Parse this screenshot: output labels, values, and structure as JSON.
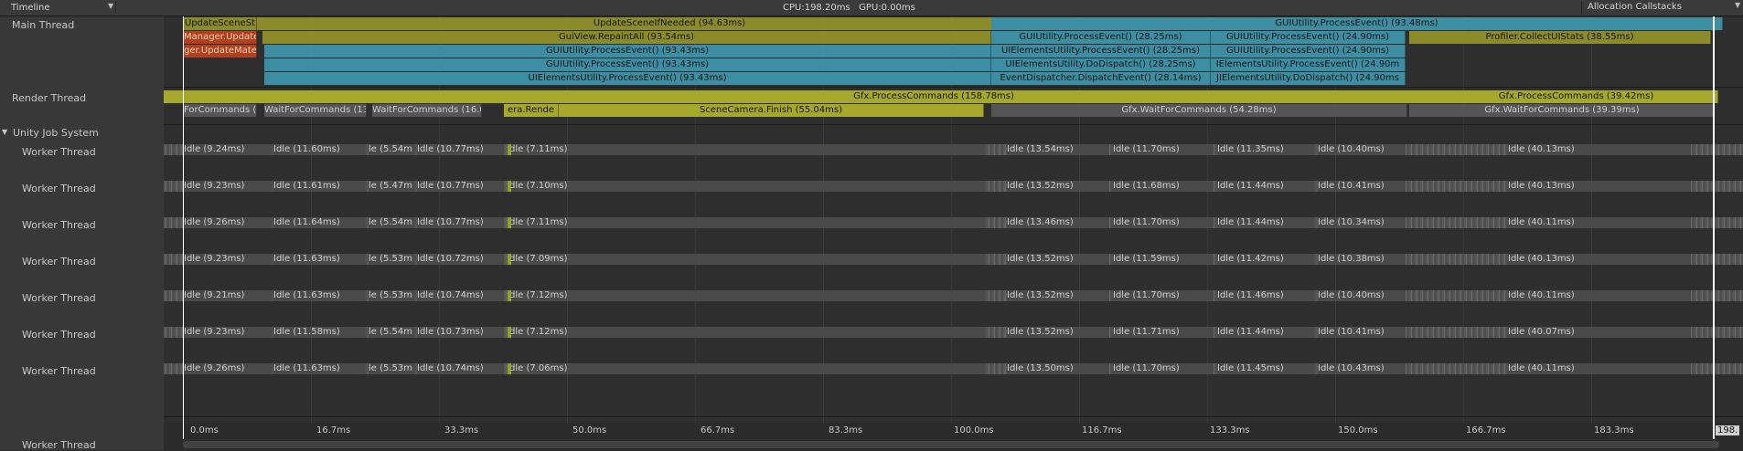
{
  "toolbar": {
    "timeline_label": "Timeline",
    "cpu_gpu": "CPU:198.20ms   GPU:0.00ms",
    "alloc_label": "Allocation Callstacks"
  },
  "threads": {
    "main": "Main Thread",
    "render": "Render Thread",
    "job_system": "Unity Job System",
    "worker": "Worker Thread"
  },
  "main_bars": {
    "r0": [
      "UpdateSceneSt",
      "UpdateSceneIfNeeded (94.63ms)",
      "GUIUtility.ProcessEvent() (93.48ms)"
    ],
    "r1": [
      "Manager.Update",
      "GuiView.RepaintAll (93.54ms)",
      "GUIUtility.ProcessEvent() (28.25ms)",
      "GUIUtility.ProcessEvent() (24.90ms)",
      "Profiler.CollectUIStats (38.55ms)"
    ],
    "r2": [
      "ger.UpdateMate",
      "GUIUtility.ProcessEvent() (93.43ms)",
      "UIElementsUtility.ProcessEvent() (28.25ms)",
      "GUIUtility.ProcessEvent() (24.90ms)"
    ],
    "r3": [
      "GUIUtility.ProcessEvent() (93.43ms)",
      "UIElementsUtility.DoDispatch() (28.25ms)",
      "IElementsUtility.ProcessEvent() (24.90m"
    ],
    "r4": [
      "UIElementsUtility.ProcessEvent() (93.43ms)",
      "EventDispatcher.DispatchEvent() (28.14ms)",
      "JIElementsUtility.DoDispatch() (24.90ms"
    ]
  },
  "render_bars": {
    "r0": [
      "Gfx.ProcessCommands (158.78ms)",
      "Gfx.ProcessCommands (39.42ms)"
    ],
    "r1": [
      "ForCommands (",
      "WaitForCommands (13.7",
      "WaitForCommands (16.01",
      "era.Rende",
      "SceneCamera.Finish (55.04ms)",
      "Gfx.WaitForCommands (54.28ms)",
      "Gfx.WaitForCommands (39.39ms)"
    ]
  },
  "worker_rows": [
    [
      "Idle (9.24ms)",
      "Idle (11.60ms)",
      "le (5.54m",
      "Idle (10.77ms)",
      "dle (7.11ms)",
      "Idle (13.54ms)",
      "Idle (11.70ms)",
      "Idle (11.35ms)",
      "Idle (10.40ms)",
      "Idle (40.13ms)"
    ],
    [
      "Idle (9.23ms)",
      "Idle (11.61ms)",
      "le (5.47m",
      "Idle (10.77ms)",
      "dle (7.10ms)",
      "Idle (13.52ms)",
      "Idle (11.68ms)",
      "Idle (11.44ms)",
      "Idle (10.41ms)",
      "Idle (40.13ms)"
    ],
    [
      "Idle (9.26ms)",
      "Idle (11.64ms)",
      "le (5.54m",
      "Idle (10.77ms)",
      "dle (7.11ms)",
      "Idle (13.46ms)",
      "Idle (11.70ms)",
      "Idle (11.44ms)",
      "Idle (10.34ms)",
      "Idle (40.11ms)"
    ],
    [
      "Idle (9.23ms)",
      "Idle (11.63ms)",
      "le (5.53m",
      "Idle (10.72ms)",
      "dle (7.09ms)",
      "Idle (13.52ms)",
      "Idle (11.59ms)",
      "Idle (11.42ms)",
      "Idle (10.38ms)",
      "Idle (40.13ms)"
    ],
    [
      "Idle (9.21ms)",
      "Idle (11.63ms)",
      "le (5.53m",
      "Idle (10.74ms)",
      "dle (7.12ms)",
      "Idle (13.52ms)",
      "Idle (11.70ms)",
      "Idle (11.46ms)",
      "Idle (10.40ms)",
      "Idle (40.11ms)"
    ],
    [
      "Idle (9.23ms)",
      "Idle (11.58ms)",
      "le (5.54m",
      "Idle (10.73ms)",
      "dle (7.12ms)",
      "Idle (13.52ms)",
      "Idle (11.71ms)",
      "Idle (11.44ms)",
      "Idle (10.41ms)",
      "Idle (40.07ms)"
    ],
    [
      "Idle (9.26ms)",
      "Idle (11.63ms)",
      "le (5.53m",
      "Idle (10.74ms)",
      "dle (7.06ms)",
      "Idle (13.50ms)",
      "Idle (11.70ms)",
      "Idle (11.45ms)",
      "Idle (10.43ms)",
      "Idle (40.11ms)"
    ]
  ],
  "ruler": [
    "0.0ms",
    "16.7ms",
    "33.3ms",
    "50.0ms",
    "66.7ms",
    "83.3ms",
    "100.0ms",
    "116.7ms",
    "133.3ms",
    "150.0ms",
    "166.7ms",
    "183.3ms"
  ],
  "end_label": "198.",
  "icons": {
    "dropdown": "chevron-down-icon",
    "foldout": "triangle-down-icon"
  }
}
